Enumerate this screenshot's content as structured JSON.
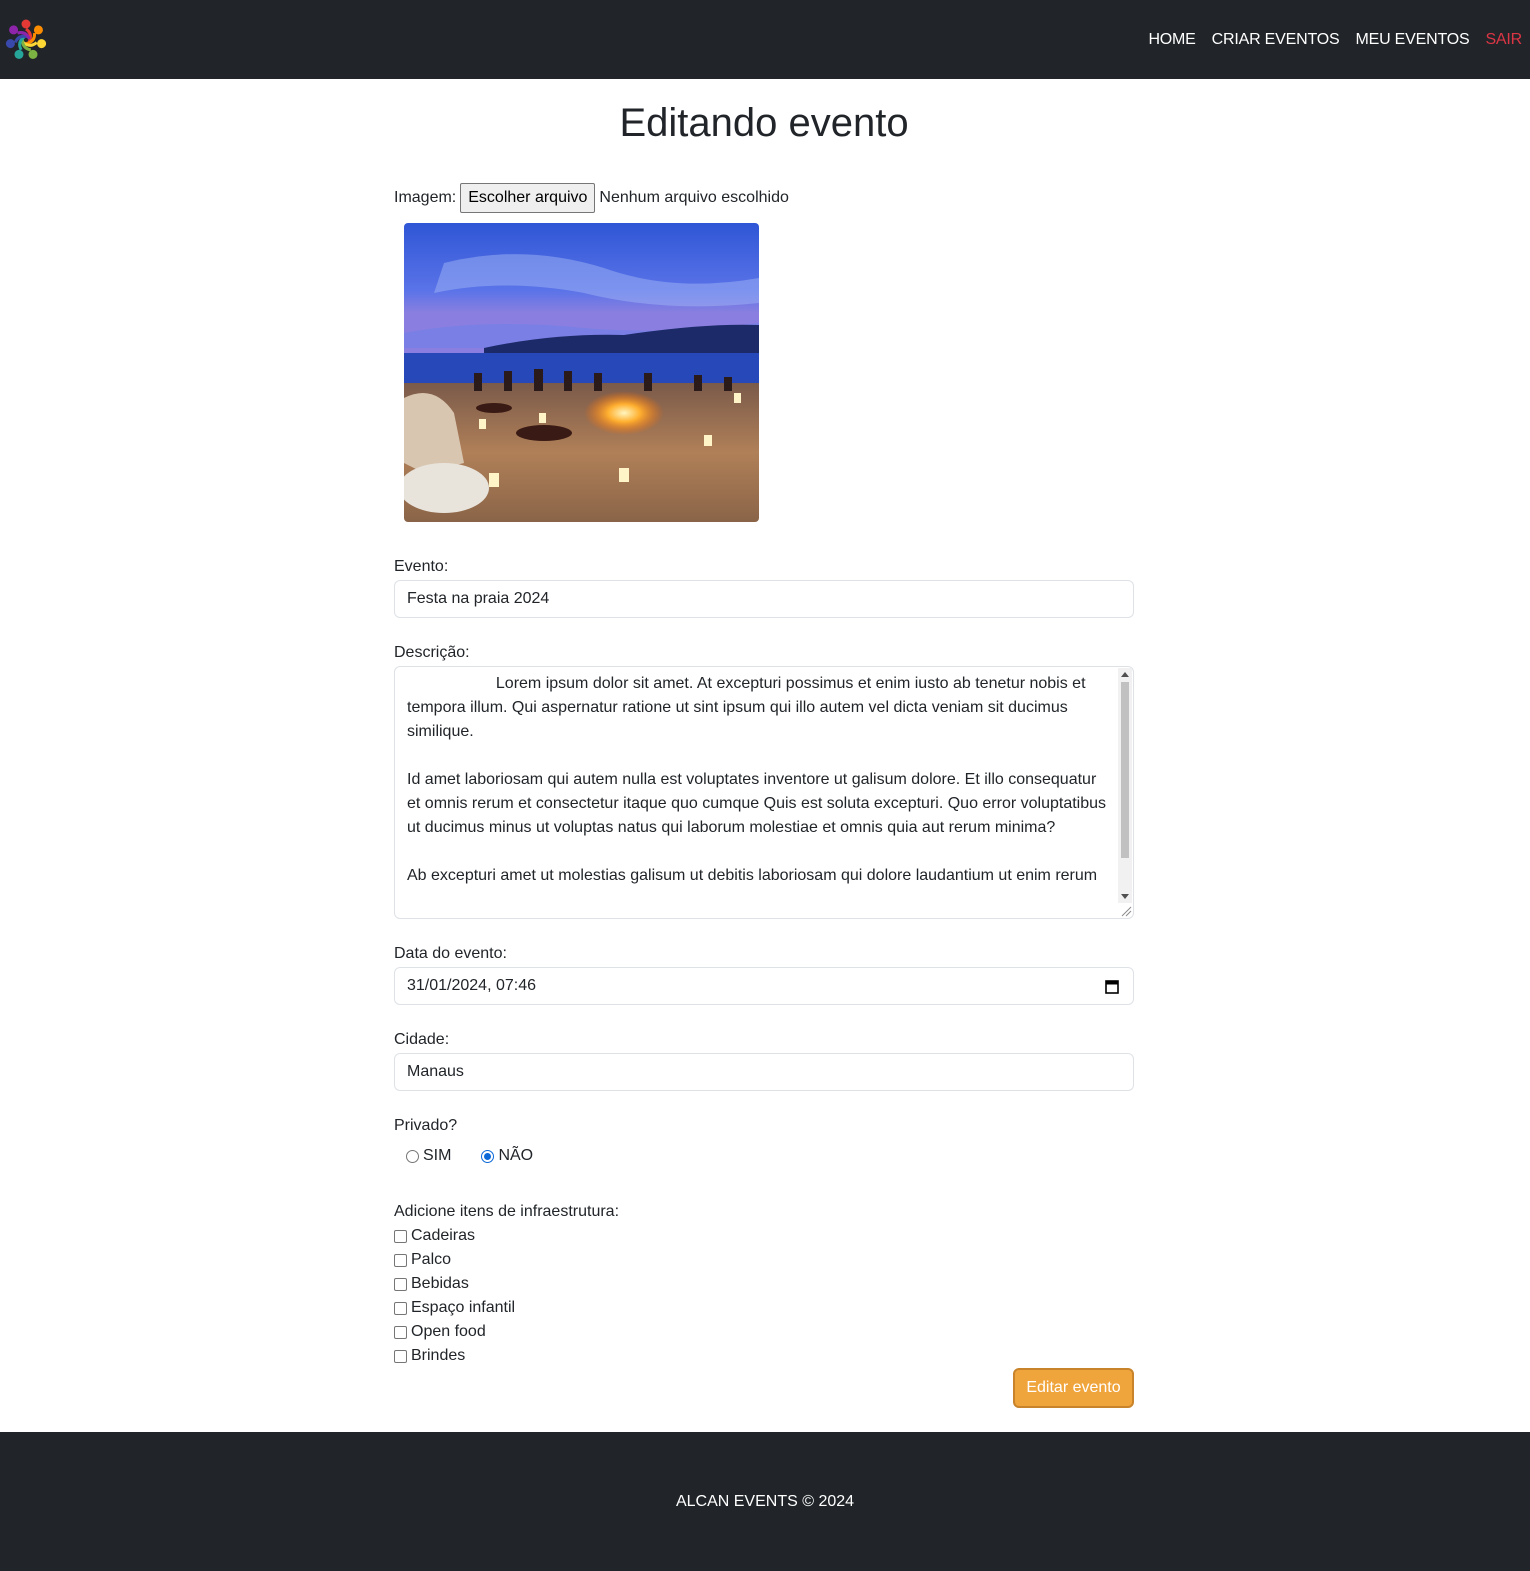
{
  "nav": {
    "logo_icon": "flower-logo-icon",
    "items": [
      {
        "label": "HOME"
      },
      {
        "label": "CRIAR EVENTOS"
      },
      {
        "label": "MEU EVENTOS"
      },
      {
        "label": "SAIR"
      }
    ],
    "exit_color": "#dc3545"
  },
  "page": {
    "title": "Editando evento"
  },
  "form": {
    "image_label": "Imagem:",
    "file_button": "Escolher arquivo",
    "file_status": "Nenhum arquivo escolhido",
    "preview_icon": "beach-party-photo",
    "event_label": "Evento:",
    "event_value": "Festa na praia 2024",
    "description_label": "Descrição:",
    "description_value": "                    Lorem ipsum dolor sit amet. At excepturi possimus et enim iusto ab tenetur nobis et tempora illum. Qui aspernatur ratione ut sint ipsum qui illo autem vel dicta veniam sit ducimus similique.\n\nId amet laboriosam qui autem nulla est voluptates inventore ut galisum dolore. Et illo consequatur et omnis rerum et consectetur itaque quo cumque Quis est soluta excepturi. Quo error voluptatibus ut ducimus minus ut voluptas natus qui laborum molestiae et omnis quia aut rerum minima?\n\nAb excepturi amet ut molestias galisum ut debitis laboriosam qui dolore laudantium ut enim rerum",
    "date_label": "Data do evento:",
    "date_value": "31/01/2024, 07:46",
    "city_label": "Cidade:",
    "city_value": "Manaus",
    "private_label": "Privado?",
    "private_options": [
      {
        "label": "SIM",
        "checked": false
      },
      {
        "label": "NÃO",
        "checked": true
      }
    ],
    "infra_label": "Adicione itens de infraestrutura:",
    "infra_items": [
      {
        "label": "Cadeiras",
        "checked": false
      },
      {
        "label": "Palco",
        "checked": false
      },
      {
        "label": "Bebidas",
        "checked": false
      },
      {
        "label": "Espaço infantil",
        "checked": false
      },
      {
        "label": "Open food",
        "checked": false
      },
      {
        "label": "Brindes",
        "checked": false
      }
    ],
    "submit_label": "Editar evento",
    "accent_color": "#f0a43c"
  },
  "footer": {
    "text": "ALCAN EVENTS © 2024"
  }
}
